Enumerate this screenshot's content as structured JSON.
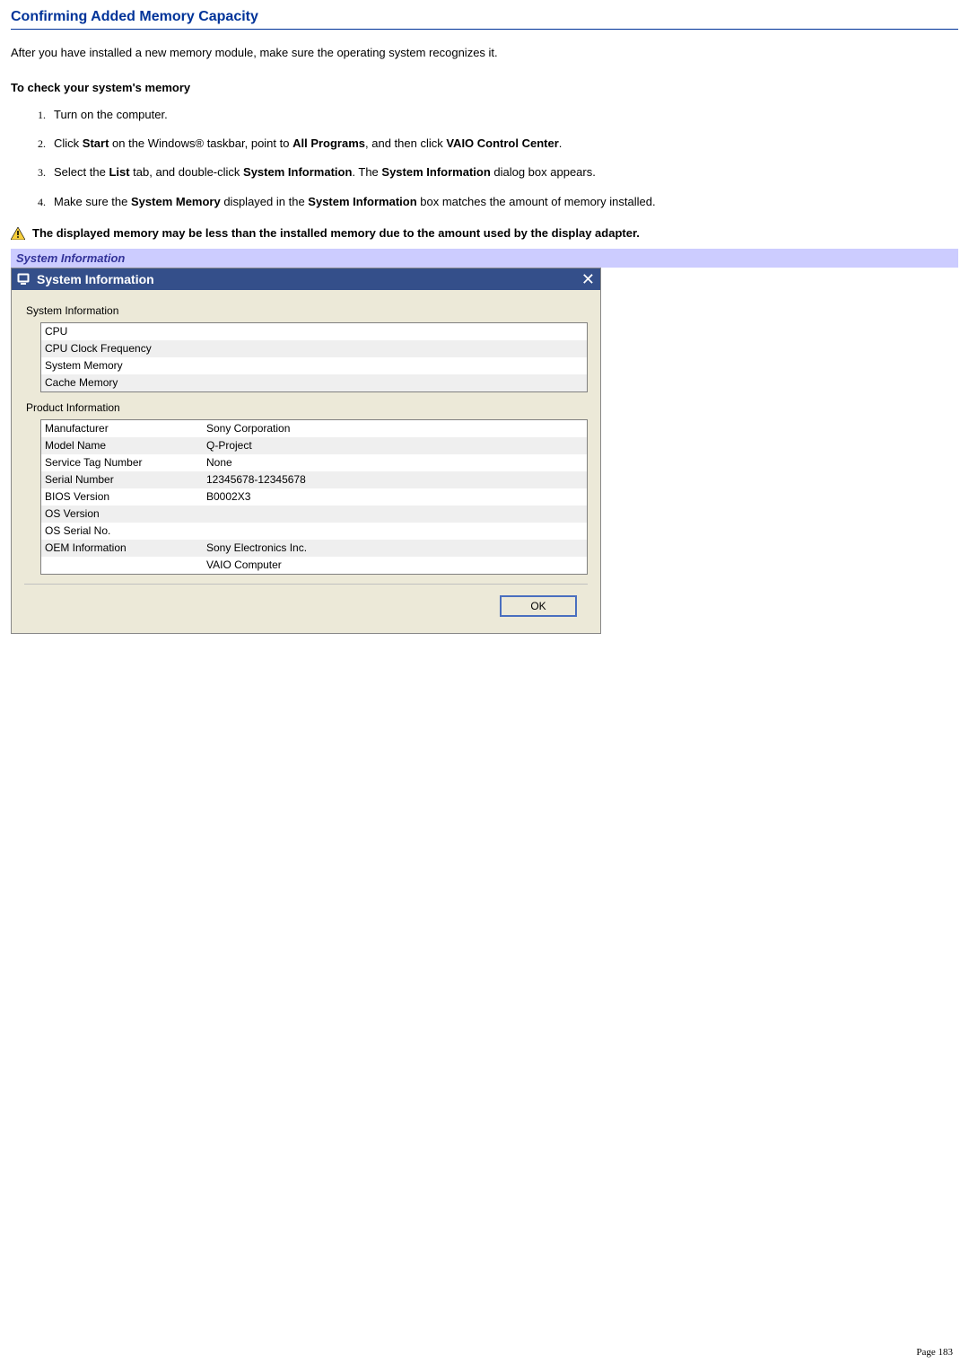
{
  "section_title": "Confirming Added Memory Capacity",
  "intro": "After you have installed a new memory module, make sure the operating system recognizes it.",
  "sub_heading": "To check your system's memory",
  "steps": {
    "s1": "Turn on the computer.",
    "s2a": "Click ",
    "s2b": "Start",
    "s2c": " on the Windows® taskbar, point to ",
    "s2d": "All Programs",
    "s2e": ", and then click ",
    "s2f": "VAIO Control Center",
    "s2g": ".",
    "s3a": "Select the ",
    "s3b": "List",
    "s3c": " tab, and double-click ",
    "s3d": "System Information",
    "s3e": ". The ",
    "s3f": "System Information",
    "s3g": " dialog box appears.",
    "s4a": "Make sure the ",
    "s4b": "System Memory",
    "s4c": " displayed in the ",
    "s4d": "System Information",
    "s4e": " box matches the amount of memory installed."
  },
  "warning": "The displayed memory may be less than the installed memory due to the amount used by the display adapter.",
  "figure_caption": "System Information",
  "dialog": {
    "title": "System Information",
    "group1_label": "System Information",
    "group1_rows": [
      {
        "label": "CPU",
        "value": ""
      },
      {
        "label": "CPU Clock Frequency",
        "value": ""
      },
      {
        "label": "System Memory",
        "value": ""
      },
      {
        "label": "Cache Memory",
        "value": ""
      }
    ],
    "group2_label": "Product Information",
    "group2_rows": [
      {
        "label": "Manufacturer",
        "value": "Sony Corporation"
      },
      {
        "label": "Model Name",
        "value": "Q-Project"
      },
      {
        "label": "Service Tag Number",
        "value": "None"
      },
      {
        "label": "Serial Number",
        "value": "12345678-12345678"
      },
      {
        "label": "BIOS Version",
        "value": "B0002X3"
      },
      {
        "label": "OS Version",
        "value": ""
      },
      {
        "label": "OS Serial No.",
        "value": ""
      },
      {
        "label": "OEM Information",
        "value": "Sony Electronics Inc."
      },
      {
        "label": "",
        "value": "VAIO Computer"
      },
      {
        "label": "",
        "value": ""
      },
      {
        "label": "",
        "value": ""
      }
    ],
    "ok_label": "OK"
  },
  "page_label": "Page 183"
}
